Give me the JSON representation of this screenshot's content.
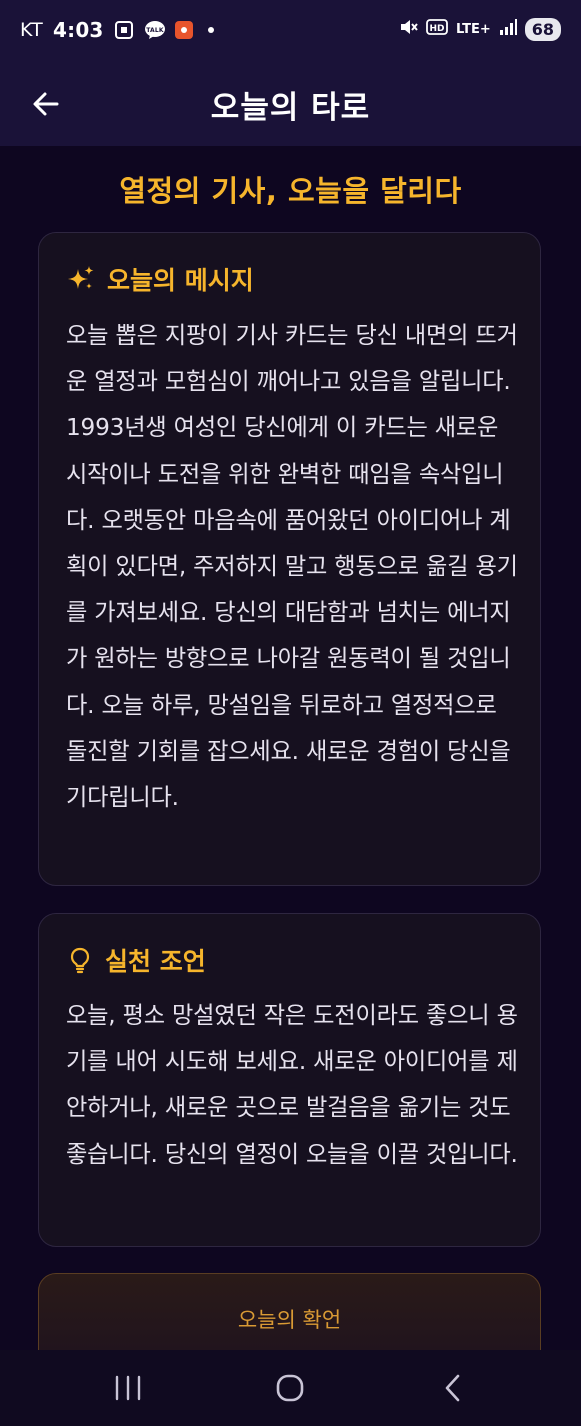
{
  "status_bar": {
    "carrier": "KT",
    "time": "4:03",
    "network": "LTE+",
    "battery": "68",
    "icons": [
      "screenshot-icon",
      "kakaotalk-icon",
      "app-notification-icon",
      "dot-icon",
      "mute-icon",
      "hd-icon",
      "signal-icon"
    ]
  },
  "header": {
    "title": "오늘의 타로",
    "back_icon": "back-arrow-icon"
  },
  "card_title": "열정의 기사, 오늘을 달리다",
  "message": {
    "icon": "sparkle-icon",
    "heading": "오늘의 메시지",
    "body": "오늘 뽑은 지팡이 기사 카드는 당신 내면의 뜨거운 열정과 모험심이 깨어나고 있음을 알립니다. 1993년생 여성인 당신에게 이 카드는 새로운 시작이나 도전을 위한 완벽한 때임을 속삭입니다. 오랫동안 마음속에 품어왔던 아이디어나 계획이 있다면, 주저하지 말고 행동으로 옮길 용기를 가져보세요. 당신의 대담함과 넘치는 에너지가 원하는 방향으로 나아갈 원동력이 될 것입니다. 오늘 하루, 망설임을 뒤로하고 열정적으로 돌진할 기회를 잡으세요. 새로운 경험이 당신을 기다립니다."
  },
  "advice": {
    "icon": "lightbulb-icon",
    "heading": "실천 조언",
    "body": "오늘, 평소 망설였던 작은 도전이라도 좋으니 용기를 내어 시도해 보세요. 새로운 아이디어를 제안하거나, 새로운 곳으로 발걸음을 옮기는 것도 좋습니다. 당신의 열정이 오늘을 이끌 것입니다."
  },
  "affirmation": {
    "label": "오늘의 확언"
  },
  "colors": {
    "accent": "#f6b52c",
    "background": "#0e0620",
    "header": "#1a1238",
    "card": "#16101f"
  }
}
